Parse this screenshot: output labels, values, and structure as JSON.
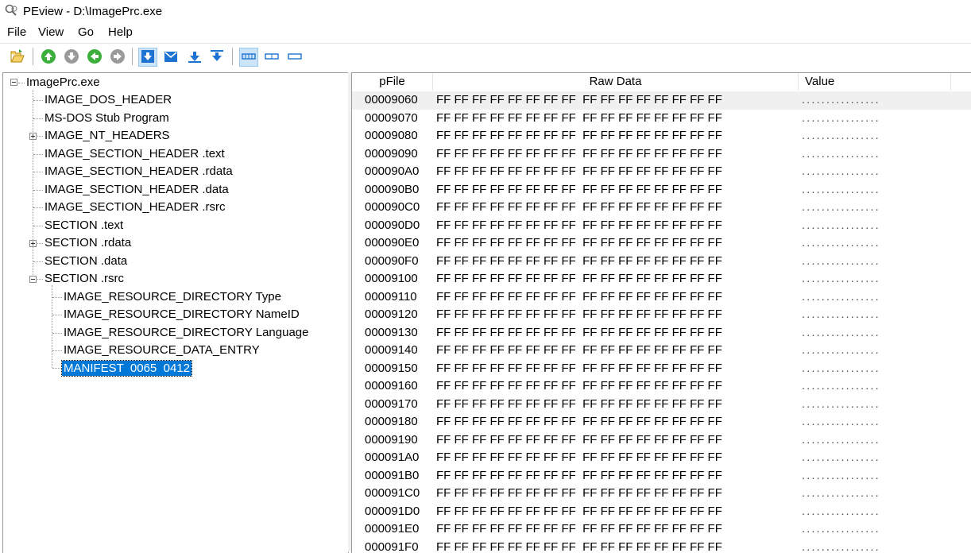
{
  "window": {
    "title": "PEview - D:\\ImagePrc.exe"
  },
  "menu": [
    "File",
    "View",
    "Go",
    "Help"
  ],
  "toolbar": {
    "icons": [
      "open-file-icon",
      "up-icon",
      "down-icon",
      "back-icon",
      "forward-icon",
      "view-down-icon",
      "view-envelope-icon",
      "view-left-icon",
      "view-right-icon",
      "byte-view-icon",
      "word-view-icon",
      "dword-view-icon"
    ]
  },
  "tree": {
    "root": "ImagePrc.exe",
    "items": [
      "IMAGE_DOS_HEADER",
      "MS-DOS Stub Program",
      "IMAGE_NT_HEADERS",
      "IMAGE_SECTION_HEADER .text",
      "IMAGE_SECTION_HEADER .rdata",
      "IMAGE_SECTION_HEADER .data",
      "IMAGE_SECTION_HEADER .rsrc",
      "SECTION .text",
      "SECTION .rdata",
      "SECTION .data",
      "SECTION .rsrc"
    ],
    "rsrc_children": [
      "IMAGE_RESOURCE_DIRECTORY Type",
      "IMAGE_RESOURCE_DIRECTORY NameID",
      "IMAGE_RESOURCE_DIRECTORY Language",
      "IMAGE_RESOURCE_DATA_ENTRY",
      "MANIFEST  0065  0412"
    ]
  },
  "hex": {
    "columns": [
      "pFile",
      "Raw Data",
      "Value"
    ],
    "bytes": "FF FF FF FF FF FF FF FF  FF FF FF FF FF FF FF FF",
    "value_dots": "................",
    "addresses": [
      "00009060",
      "00009070",
      "00009080",
      "00009090",
      "000090A0",
      "000090B0",
      "000090C0",
      "000090D0",
      "000090E0",
      "000090F0",
      "00009100",
      "00009110",
      "00009120",
      "00009130",
      "00009140",
      "00009150",
      "00009160",
      "00009170",
      "00009180",
      "00009190",
      "000091A0",
      "000091B0",
      "000091C0",
      "000091D0",
      "000091E0",
      "000091F0"
    ]
  }
}
